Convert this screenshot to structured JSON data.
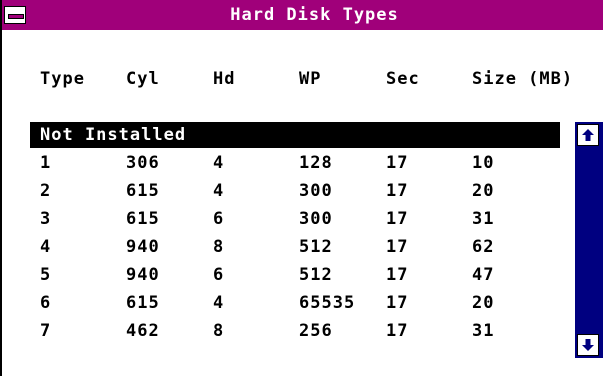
{
  "window": {
    "title": "Hard Disk Types"
  },
  "columns": [
    "Type",
    "Cyl",
    "Hd",
    "WP",
    "Sec",
    "Size (MB)"
  ],
  "list": {
    "selected_label": "Not Installed",
    "rows": [
      [
        "1",
        "306",
        "4",
        "128",
        "17",
        "10"
      ],
      [
        "2",
        "615",
        "4",
        "300",
        "17",
        "20"
      ],
      [
        "3",
        "615",
        "6",
        "300",
        "17",
        "31"
      ],
      [
        "4",
        "940",
        "8",
        "512",
        "17",
        "62"
      ],
      [
        "5",
        "940",
        "6",
        "512",
        "17",
        "47"
      ],
      [
        "6",
        "615",
        "4",
        "65535",
        "17",
        "20"
      ],
      [
        "7",
        "462",
        "8",
        "256",
        "17",
        "31"
      ]
    ]
  },
  "colors": {
    "titlebar": "#a0007a",
    "scrollbar": "#000080",
    "selection": "#000000"
  },
  "icons": {
    "system_menu": "system-menu-icon",
    "scroll_up": "arrow-up-icon",
    "scroll_down": "arrow-down-icon"
  }
}
